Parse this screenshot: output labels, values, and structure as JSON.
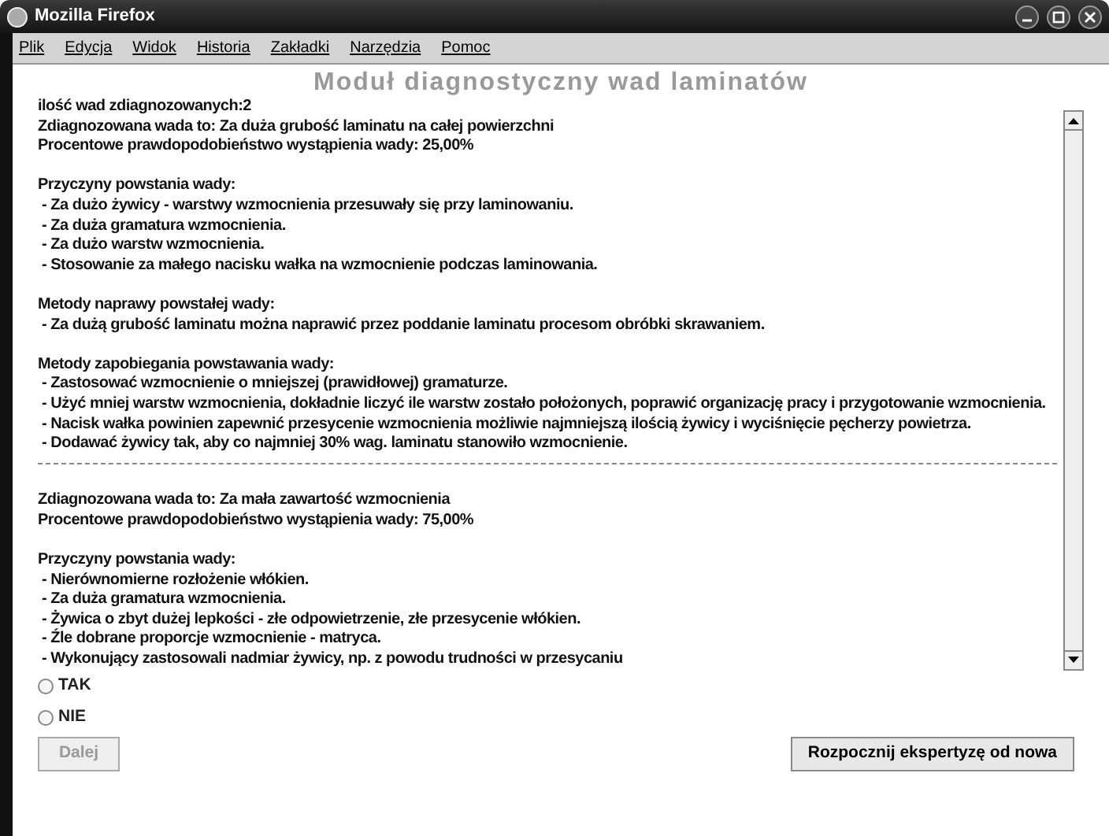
{
  "window": {
    "title": "Mozilla Firefox"
  },
  "menu": [
    "Plik",
    "Edycja",
    "Widok",
    "Historia",
    "Zakładki",
    "Narzędzia",
    "Pomoc"
  ],
  "heading": "Moduł diagnostyczny wad laminatów",
  "content": [
    {
      "kind": "line",
      "text": "ilość wad zdiagnozowanych:2"
    },
    {
      "kind": "line",
      "text": "Zdiagnozowana wada to: Za duża grubość laminatu na całej powierzchni"
    },
    {
      "kind": "line",
      "text": "Procentowe prawdopodobieństwo wystąpienia wady: 25,00%"
    },
    {
      "kind": "gap"
    },
    {
      "kind": "line",
      "text": "Przyczyny powstania wady:"
    },
    {
      "kind": "line",
      "text": " - Za dużo żywicy - warstwy wzmocnienia przesuwały się przy laminowaniu."
    },
    {
      "kind": "line",
      "text": " - Za duża gramatura wzmocnienia."
    },
    {
      "kind": "line",
      "text": " - Za dużo warstw wzmocnienia."
    },
    {
      "kind": "line",
      "text": " - Stosowanie za małego nacisku wałka na wzmocnienie podczas laminowania."
    },
    {
      "kind": "gap"
    },
    {
      "kind": "line",
      "text": "Metody naprawy powstałej wady:"
    },
    {
      "kind": "line",
      "text": " - Za dużą grubość laminatu można naprawić przez poddanie laminatu procesom obróbki skrawaniem."
    },
    {
      "kind": "gap"
    },
    {
      "kind": "line",
      "text": "Metody zapobiegania powstawania wady:"
    },
    {
      "kind": "line",
      "text": " - Zastosować wzmocnienie o mniejszej (prawidłowej) gramaturze."
    },
    {
      "kind": "line",
      "text": " - Użyć mniej warstw wzmocnienia, dokładnie liczyć ile warstw zostało położonych, poprawić organizację pracy i przygotowanie wzmocnienia."
    },
    {
      "kind": "line",
      "text": " - Nacisk wałka powinien zapewnić przesycenie wzmocnienia możliwie najmniejszą ilością żywicy i wyciśnięcie pęcherzy powietrza."
    },
    {
      "kind": "line",
      "text": " - Dodawać żywicy tak, aby co najmniej 30% wag. laminatu stanowiło wzmocnienie."
    },
    {
      "kind": "rule"
    },
    {
      "kind": "gap"
    },
    {
      "kind": "line",
      "text": "Zdiagnozowana wada to: Za mała zawartość wzmocnienia"
    },
    {
      "kind": "line",
      "text": "Procentowe prawdopodobieństwo wystąpienia wady: 75,00%"
    },
    {
      "kind": "gap"
    },
    {
      "kind": "line",
      "text": "Przyczyny powstania wady:"
    },
    {
      "kind": "line",
      "text": " - Nierównomierne rozłożenie włókien."
    },
    {
      "kind": "line",
      "text": " - Za duża gramatura wzmocnienia."
    },
    {
      "kind": "line",
      "text": " - Żywica o zbyt dużej lepkości - złe odpowietrzenie, złe przesycenie włókien."
    },
    {
      "kind": "line",
      "text": " - Źle dobrane proporcje wzmocnienie - matryca."
    },
    {
      "kind": "line",
      "text": " - Wykonujący zastosowali nadmiar żywicy, np. z powodu trudności w przesycaniu"
    }
  ],
  "options": [
    {
      "label": "TAK",
      "selected": false
    },
    {
      "label": "NIE",
      "selected": false
    }
  ],
  "next_button": {
    "label": "Dalej",
    "disabled": true
  },
  "restart_button": {
    "label": "Rozpocznij ekspertyzę od nowa"
  }
}
